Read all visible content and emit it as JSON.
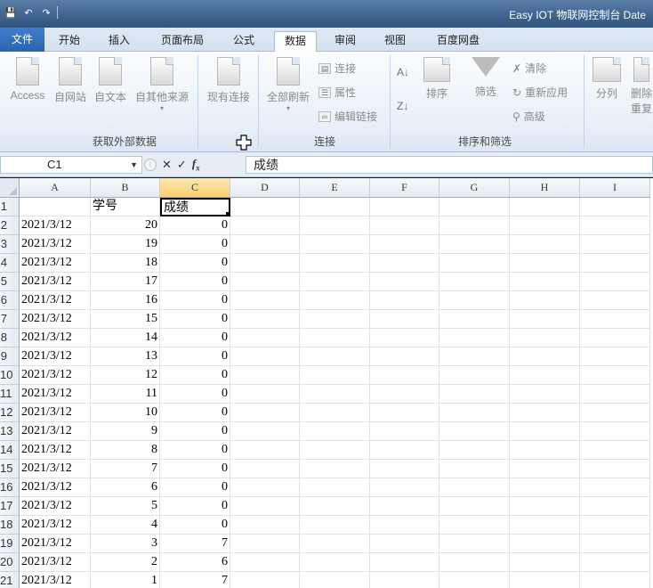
{
  "window": {
    "title": "Easy IOT 物联网控制台 Date"
  },
  "qat": {
    "save": "💾",
    "undo": "↶",
    "redo": "↷"
  },
  "ribbon_tabs": [
    "文件",
    "开始",
    "插入",
    "页面布局",
    "公式",
    "数据",
    "审阅",
    "视图",
    "百度网盘"
  ],
  "active_tab": "数据",
  "ribbon": {
    "get_external": {
      "label": "获取外部数据",
      "buttons": [
        "Access",
        "自网站",
        "自文本",
        "自其他来源",
        "现有连接"
      ]
    },
    "connections": {
      "label": "连接",
      "refresh_all": "全部刷新",
      "connect": "连接",
      "properties": "属性",
      "edit_links": "编辑链接"
    },
    "sort_filter": {
      "label": "排序和筛选",
      "sort": "排序",
      "filter": "筛选",
      "clear": "清除",
      "reapply": "重新应用",
      "advanced": "高级"
    },
    "data_tools": {
      "split": "分列",
      "delete": "删除",
      "repeat": "重复"
    }
  },
  "formula_bar": {
    "name_box": "C1",
    "formula": "成绩"
  },
  "columns": [
    "A",
    "B",
    "C",
    "D",
    "E",
    "F",
    "G",
    "H",
    "I"
  ],
  "selected_column": "C",
  "header_row": {
    "A": "",
    "B": "学号",
    "C": "成绩"
  },
  "row_numbers": [
    "1",
    "2",
    "3",
    "4",
    "5",
    "6",
    "7",
    "8",
    "9",
    "10",
    "11",
    "12",
    "13",
    "14",
    "15",
    "16",
    "17",
    "18",
    "19",
    "20",
    "21"
  ],
  "rows": [
    {
      "a": "2021/3/12",
      "b": "20",
      "c": "0"
    },
    {
      "a": "2021/3/12",
      "b": "19",
      "c": "0"
    },
    {
      "a": "2021/3/12",
      "b": "18",
      "c": "0"
    },
    {
      "a": "2021/3/12",
      "b": "17",
      "c": "0"
    },
    {
      "a": "2021/3/12",
      "b": "16",
      "c": "0"
    },
    {
      "a": "2021/3/12",
      "b": "15",
      "c": "0"
    },
    {
      "a": "2021/3/12",
      "b": "14",
      "c": "0"
    },
    {
      "a": "2021/3/12",
      "b": "13",
      "c": "0"
    },
    {
      "a": "2021/3/12",
      "b": "12",
      "c": "0"
    },
    {
      "a": "2021/3/12",
      "b": "11",
      "c": "0"
    },
    {
      "a": "2021/3/12",
      "b": "10",
      "c": "0"
    },
    {
      "a": "2021/3/12",
      "b": "9",
      "c": "0"
    },
    {
      "a": "2021/3/12",
      "b": "8",
      "c": "0"
    },
    {
      "a": "2021/3/12",
      "b": "7",
      "c": "0"
    },
    {
      "a": "2021/3/12",
      "b": "6",
      "c": "0"
    },
    {
      "a": "2021/3/12",
      "b": "5",
      "c": "0"
    },
    {
      "a": "2021/3/12",
      "b": "4",
      "c": "0"
    },
    {
      "a": "2021/3/12",
      "b": "3",
      "c": "7"
    },
    {
      "a": "2021/3/12",
      "b": "2",
      "c": "6"
    },
    {
      "a": "2021/3/12",
      "b": "1",
      "c": "7"
    }
  ]
}
